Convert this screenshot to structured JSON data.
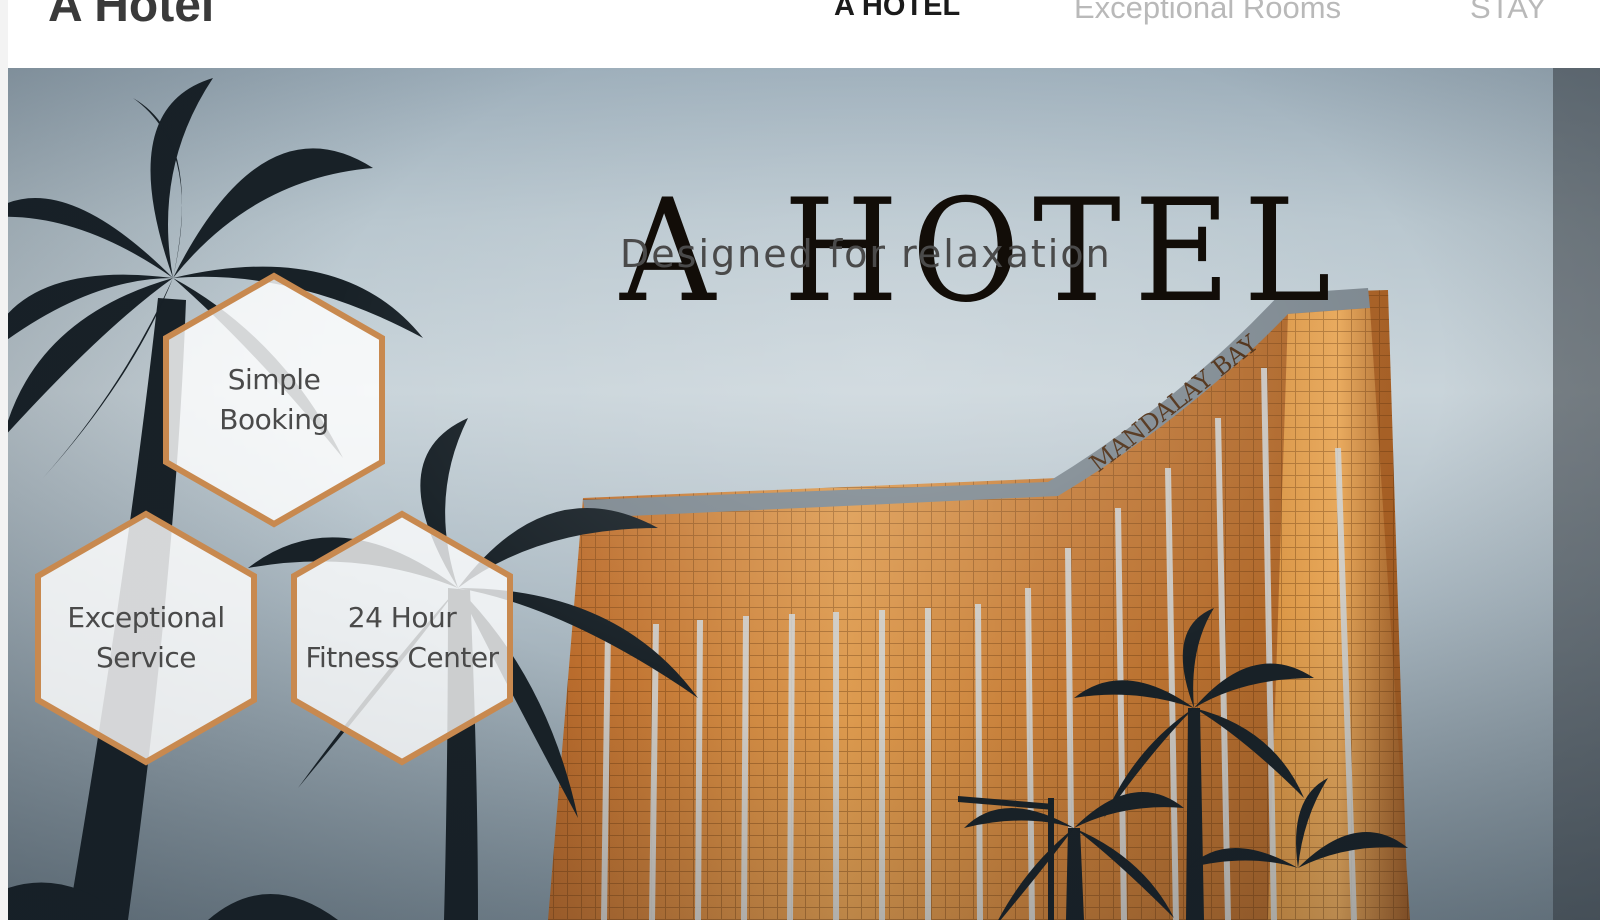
{
  "header": {
    "site_title": "A Hotel",
    "nav": [
      {
        "label": "A HOTEL",
        "active": true
      },
      {
        "label": "Exceptional Rooms",
        "active": false
      },
      {
        "label": "STAY",
        "active": false
      }
    ]
  },
  "hero": {
    "title": "A HOTEL",
    "subtitle": "Designed for relaxation",
    "building_sign": "MANDALAY BAY",
    "features": [
      {
        "line1": "Simple",
        "line2": "Booking"
      },
      {
        "line1": "Exceptional",
        "line2": "Service"
      },
      {
        "line1": "24 Hour",
        "line2": "Fitness Center"
      }
    ]
  },
  "colors": {
    "accent": "#c8894f",
    "title": "#120d08",
    "subtitle": "#4a4a4a",
    "nav_active": "#1a1a1a",
    "nav_inactive": "#b9b9b9",
    "building_gold": "#d18a3c"
  }
}
